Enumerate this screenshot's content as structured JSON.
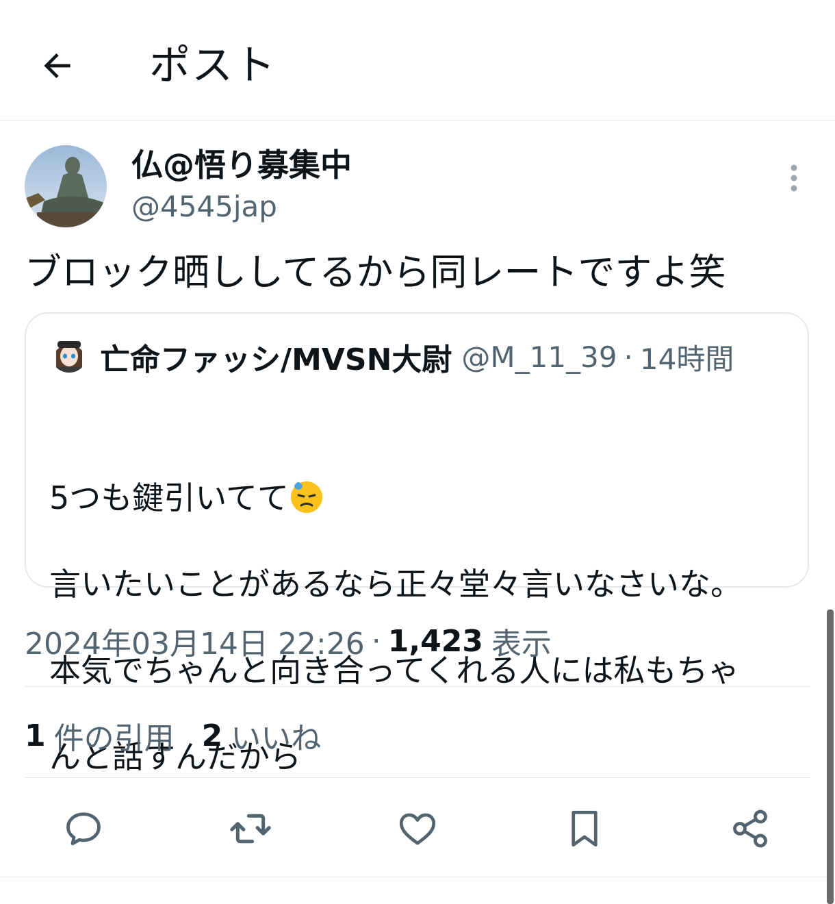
{
  "header": {
    "title": "ポスト"
  },
  "author": {
    "name": "仏@悟り募集中",
    "handle": "@4545jap"
  },
  "tweet": {
    "text": "ブロック晒ししてるから同レートですよ笑"
  },
  "quote": {
    "name": "亡命ファッシ/MVSN大尉",
    "handle": "@M_11_39",
    "separator": "·",
    "time": "14時間",
    "line1": "5つも鍵引いてて",
    "line2": "言いたいことがあるなら正々堂々言いなさいな。",
    "line3": "本気でちゃんと向き合ってくれる人には私もちゃ",
    "line4": "んと話すんだから"
  },
  "meta": {
    "date": "2024年03月14日 22:26",
    "separator": "·",
    "views_count": "1,423",
    "views_label": "表示"
  },
  "stats": {
    "quotes_count": "1",
    "quotes_label": "件の引用",
    "likes_count": "2",
    "likes_label": "いいね"
  },
  "icons": {
    "back": "arrow-left-icon",
    "more": "more-vertical-icon",
    "reply": "reply-icon",
    "retweet": "retweet-icon",
    "like": "heart-icon",
    "bookmark": "bookmark-icon",
    "share": "share-icon"
  },
  "colors": {
    "text": "#0f1419",
    "secondary": "#536471",
    "divider": "#e6ebee"
  }
}
